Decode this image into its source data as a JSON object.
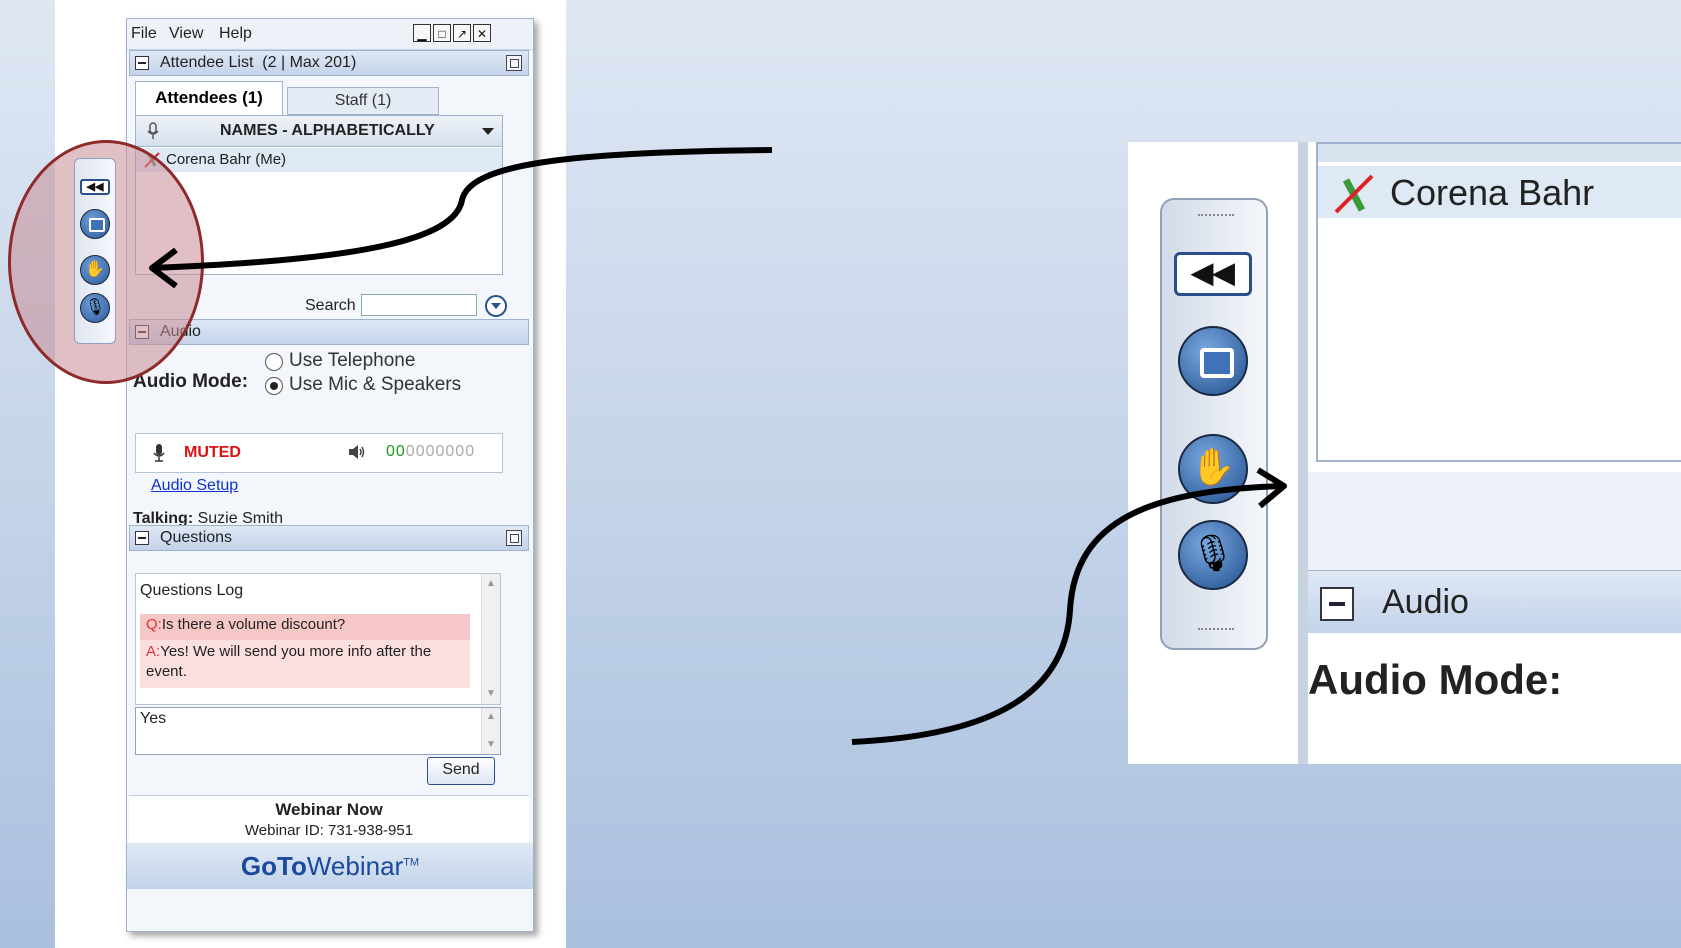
{
  "menu": {
    "file": "File",
    "view": "View",
    "help": "Help"
  },
  "window_controls": {
    "minimize": "▁",
    "restore": "□",
    "popout": "↗",
    "close": "✕"
  },
  "attendee_section": {
    "title": "Attendee List",
    "count": "(2 | Max 201)",
    "tabs": {
      "attendees": "Attendees (1)",
      "staff": "Staff (1)"
    },
    "sort_header": "NAMES - ALPHABETICALLY",
    "rows": [
      {
        "name": "Corena Bahr (Me)"
      }
    ],
    "search_label": "Search",
    "search_value": ""
  },
  "audio_section": {
    "title": "Audio",
    "mode_label": "Audio Mode:",
    "options": [
      {
        "label": "Use Telephone",
        "selected": false
      },
      {
        "label": "Use Mic & Speakers",
        "selected": true
      }
    ],
    "muted_text": "MUTED",
    "level_active": "00",
    "level_inactive": "0000000",
    "setup_link": "Audio Setup",
    "talking_label": "Talking:",
    "talking_name": "Suzie Smith"
  },
  "questions_section": {
    "title": "Questions",
    "log_title": "Questions Log",
    "question_prefix": "Q:",
    "question": "Is there a volume discount?",
    "answer_prefix": "A:",
    "answer": "Yes! We will send you more info after the event.",
    "reply_text": "Yes",
    "send_label": "Send"
  },
  "footer": {
    "webinar_name": "Webinar Now",
    "webinar_id": "Webinar ID: 731-938-951",
    "logo_bold": "GoTo",
    "logo_light": "Webinar",
    "logo_tm": "TM"
  },
  "zoom_callout": {
    "row_name": "Corena Bahr",
    "audio_title": "Audio",
    "audio_mode_label": "Audio Mode:",
    "rewind_glyph": "◀◀",
    "hand_glyph": "✋",
    "mute_glyph": "🎙"
  },
  "colors": {
    "muted": "#dd1111",
    "level_green": "#1a9a1a",
    "link": "#1030cc",
    "highlight_ellipse": "#8e2a2a",
    "question_bg": "#f6c7c7"
  },
  "icons": [
    "microphone-icon",
    "speaker-icon",
    "rewind-icon",
    "screen-icon",
    "raise-hand-icon",
    "mute-icon",
    "search-go-icon"
  ]
}
